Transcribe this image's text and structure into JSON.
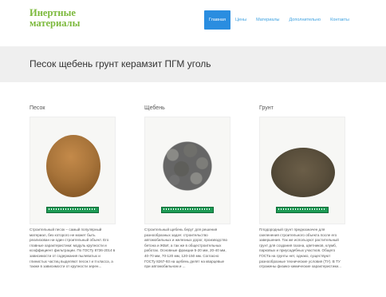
{
  "header": {
    "logo_line1": "Инертные",
    "logo_line2": "материалы",
    "nav": [
      {
        "label": "Главная",
        "active": true
      },
      {
        "label": "Цены",
        "active": false
      },
      {
        "label": "Материалы",
        "active": false
      },
      {
        "label": "Дополнительно",
        "active": false
      },
      {
        "label": "Контакты",
        "active": false
      }
    ]
  },
  "banner": {
    "title": "Песок щебень грунт керамзит ПГМ уголь"
  },
  "colors": {
    "accent": "#2a8de0",
    "logo": "#7cb93c",
    "banner_bg": "#efefef"
  },
  "materials": [
    {
      "title": "Песок",
      "image_icon": "sand-pile-photo",
      "description": "Строительный песок – самый популярный материал, без которого не может быть реализован ни один строительный объект. Его главные характеристики: модуль крупности и коэффициент фильтрации. По ГОСТу 8736-2014 в зависимости от содержания пылеватых и глинистых частиц выделяют песок I и II класса, а также в зависимости от крупности зерен..."
    },
    {
      "title": "Щебень",
      "image_icon": "gravel-pile-photo",
      "description": "Строительный щебень берут для решения разнообразных задач: строительство автомобильных и железных дорог, производство бетона и ЖБИ, а так же в общестроительных работах. Основные фракции 5-20 мм, 20-40 мм, 40-70 мм, 70-120 мм, 120-150 мм. Согласно ГОСТу 8267-93 на щебень делят на кварцевые при автомобильном и ..."
    },
    {
      "title": "Грунт",
      "image_icon": "soil-pile-photo",
      "description": "Плодородный грунт предназначен для озеленения строительного объекта после его завершения. Так же используют растительный грунт для создания газона, цветников, клумб, парковых и приусадебных участков. Общего ГОСТа на грунты нет, однако, существуют разнообразные технические условия (ТУ). В ТУ отражены физико-химические характеристики..."
    }
  ]
}
